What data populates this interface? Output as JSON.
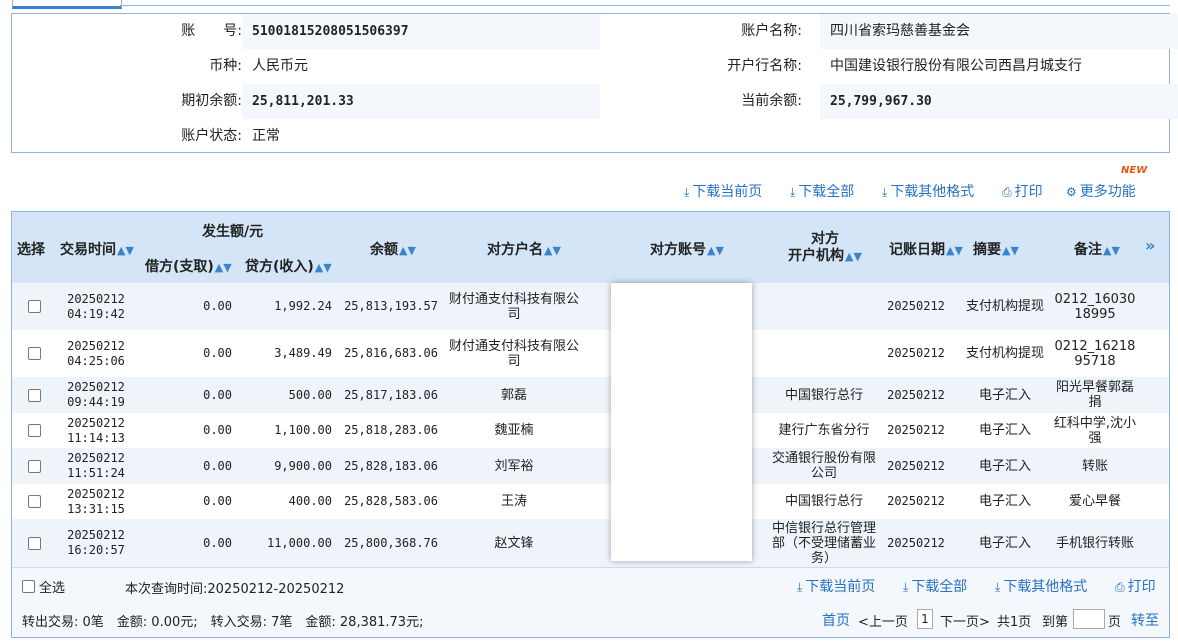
{
  "account": {
    "number_label": "账　　号:",
    "number": "5100181520805150639 7",
    "name_label": "账户名称:",
    "name": "四川省索玛慈善基金会",
    "currency_label": "币种:",
    "currency": "人民币元",
    "bank_label": "开户行名称:",
    "bank": "中国建设银行股份有限公司西昌月城支行",
    "opening_balance_label": "期初余额:",
    "opening_balance": "25,811,201.33",
    "current_balance_label": "当前余额:",
    "current_balance": "25,799,967.30",
    "status_label": "账户状态:",
    "status": "正常"
  },
  "actions_top": {
    "download_current": "下载当前页",
    "download_all": "下载全部",
    "download_other": "下载其他格式",
    "print": "打印",
    "more": "更多功能",
    "new_badge": "NEW"
  },
  "table": {
    "headers": {
      "select": "选择",
      "time": "交易时间",
      "amount_group": "发生额/元",
      "debit": "借方(支取)",
      "credit": "贷方(收入)",
      "balance": "余额",
      "party_name": "对方户名",
      "party_account": "对方账号",
      "party_bank": "对方\n开户机构",
      "post_date": "记账日期",
      "summary": "摘要",
      "remark": "备注"
    },
    "rows": [
      {
        "date": "20250212",
        "time": "04:19:42",
        "debit": "0.00",
        "credit": "1,992.24",
        "balance": "25,813,193.57",
        "party": "财付通支付科技有限公司",
        "bank": "",
        "post": "20250212",
        "summary": "支付机构提现",
        "remark": "0212_16030\n18995"
      },
      {
        "date": "20250212",
        "time": "04:25:06",
        "debit": "0.00",
        "credit": "3,489.49",
        "balance": "25,816,683.06",
        "party": "财付通支付科技有限公司",
        "bank": "",
        "post": "20250212",
        "summary": "支付机构提现",
        "remark": "0212_16218\n95718"
      },
      {
        "date": "20250212",
        "time": "09:44:19",
        "debit": "0.00",
        "credit": "500.00",
        "balance": "25,817,183.06",
        "party": "郭磊",
        "bank": "中国银行总行",
        "post": "20250212",
        "summary": "电子汇入",
        "remark": "阳光早餐郭磊捐"
      },
      {
        "date": "20250212",
        "time": "11:14:13",
        "debit": "0.00",
        "credit": "1,100.00",
        "balance": "25,818,283.06",
        "party": "魏亚楠",
        "bank": "建行广东省分行",
        "post": "20250212",
        "summary": "电子汇入",
        "remark": "红科中学,沈小强"
      },
      {
        "date": "20250212",
        "time": "11:51:24",
        "debit": "0.00",
        "credit": "9,900.00",
        "balance": "25,828,183.06",
        "party": "刘军裕",
        "bank": "交通银行股份有限公司",
        "post": "20250212",
        "summary": "电子汇入",
        "remark": "转账"
      },
      {
        "date": "20250212",
        "time": "13:31:15",
        "debit": "0.00",
        "credit": "400.00",
        "balance": "25,828,583.06",
        "party": "王涛",
        "bank": "中国银行总行",
        "post": "20250212",
        "summary": "电子汇入",
        "remark": "爱心早餐"
      },
      {
        "date": "20250212",
        "time": "16:20:57",
        "debit": "0.00",
        "credit": "11,000.00",
        "balance": "25,800,368.76",
        "party": "赵文锋",
        "bank": "中信银行总行管理部（不受理储蓄业务）",
        "post": "20250212",
        "summary": "电子汇入",
        "remark": "手机银行转账"
      }
    ]
  },
  "footer": {
    "select_all": "全选",
    "query_time": "本次查询时间:20250212-20250212",
    "download_current": "下载当前页",
    "download_all": "下载全部",
    "download_other": "下载其他格式",
    "print": "打印",
    "summary": "转出交易: 0笔　金额: 0.00元;　转入交易: 7笔　金额: 28,381.73元;",
    "first": "首页",
    "prev": "<上一页",
    "page": "1",
    "next": "下一页>",
    "total": "共1页",
    "goto": "到第",
    "page_unit": "页",
    "go": "转至"
  }
}
